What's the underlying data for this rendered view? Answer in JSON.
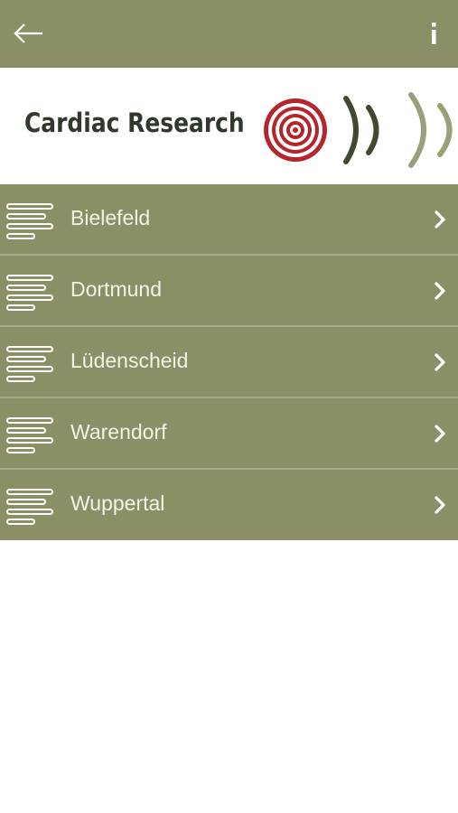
{
  "header": {
    "back_icon": "arrow-left-icon",
    "info_icon": "info-icon"
  },
  "banner": {
    "title": "Cardiac Research",
    "logo_icon": "target-circles-icon",
    "waves_icon": "signal-waves-icon"
  },
  "list": {
    "items": [
      {
        "label": "Bielefeld"
      },
      {
        "label": "Dortmund"
      },
      {
        "label": "Lüdenscheid"
      },
      {
        "label": "Warendorf"
      },
      {
        "label": "Wuppertal"
      }
    ],
    "item_icon": "text-lines-icon",
    "chevron_icon": "chevron-right-icon"
  },
  "colors": {
    "header_bg": "#8c8f66",
    "list_bg": "#8c8f66",
    "divider": "#a7a985",
    "text": "#f3f3ea",
    "logo_red": "#b3262c",
    "wave_dark": "#3f4a2e",
    "wave_light": "#9aa07a"
  }
}
